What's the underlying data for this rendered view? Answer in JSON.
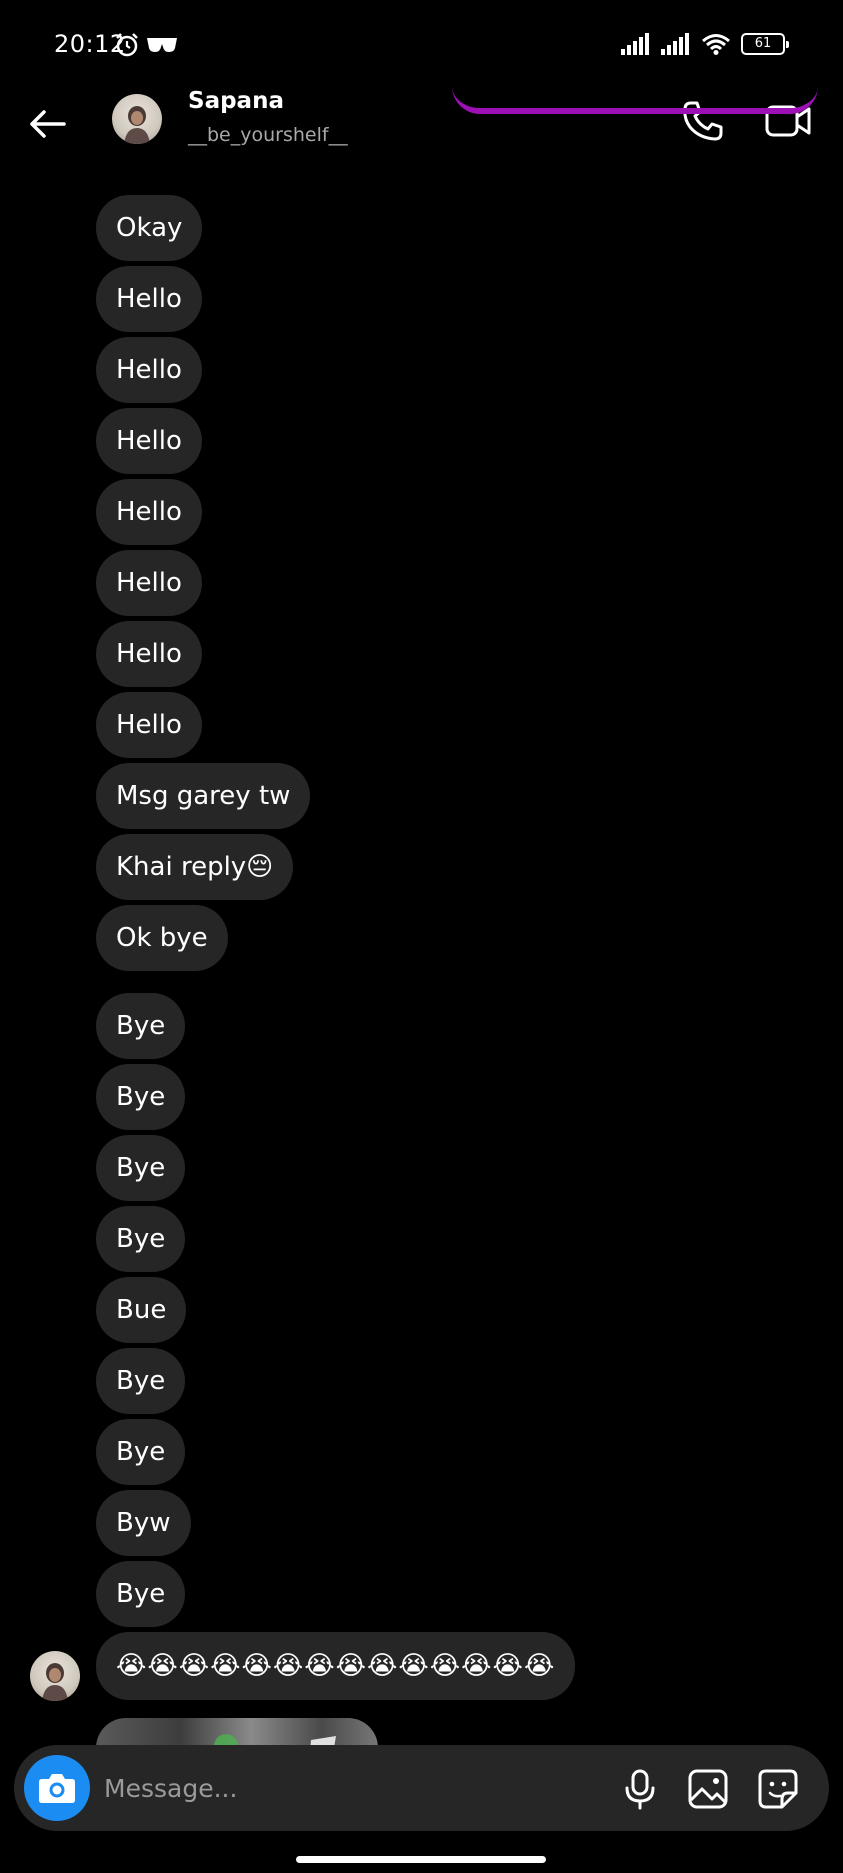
{
  "status_bar": {
    "time": "20:12",
    "battery": "61",
    "icons": [
      "alarm-icon",
      "glasses-icon",
      "signal-icon",
      "signal-icon",
      "wifi-icon",
      "battery-icon"
    ]
  },
  "header": {
    "name": "Sapana",
    "username": "__be_yourshelf__",
    "icons": [
      "back-arrow-icon",
      "phone-icon",
      "video-camera-icon"
    ]
  },
  "messages": [
    {
      "text": "Okay"
    },
    {
      "text": "Hello"
    },
    {
      "text": "Hello"
    },
    {
      "text": "Hello"
    },
    {
      "text": "Hello"
    },
    {
      "text": "Hello"
    },
    {
      "text": "Hello"
    },
    {
      "text": "Hello"
    },
    {
      "text": "Msg garey tw"
    },
    {
      "text": "Khai reply😔"
    },
    {
      "text": "Ok bye"
    },
    {
      "text": "Bye"
    },
    {
      "text": "Bye"
    },
    {
      "text": "Bye"
    },
    {
      "text": "Bye"
    },
    {
      "text": "Bue"
    },
    {
      "text": "Bye"
    },
    {
      "text": "Bye"
    },
    {
      "text": "Byw"
    },
    {
      "text": "Bye"
    },
    {
      "text": "😭😭😭😭😭😭😭😭😭😭😭😭😭😭"
    }
  ],
  "composer": {
    "placeholder": "Message...",
    "icons": [
      "camera-icon",
      "microphone-icon",
      "gallery-icon",
      "sticker-icon"
    ]
  },
  "colors": {
    "background": "#000000",
    "bubble": "#262626",
    "accent_blue": "#1b8cf2",
    "accent_purple": "#9c10b6"
  }
}
